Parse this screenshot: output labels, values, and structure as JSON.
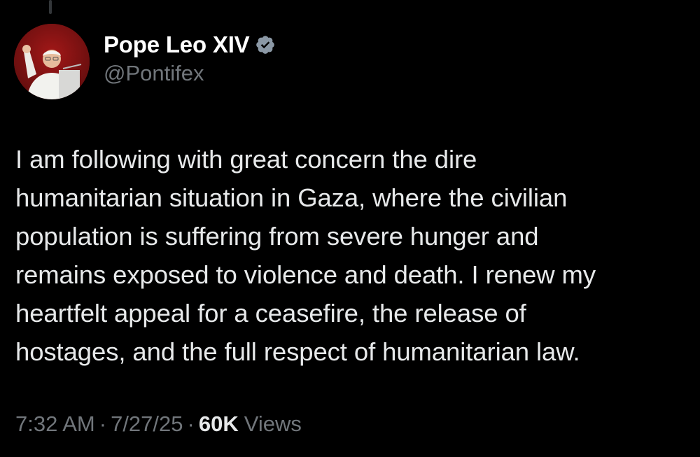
{
  "author": {
    "display_name": "Pope Leo XIV",
    "handle": "@Pontifex",
    "verified": true,
    "verified_icon": "verified-badge-icon",
    "verified_color": "#8b98a5"
  },
  "tweet": {
    "text": "I am following with great concern the dire\nhumanitarian situation in Gaza, where the civilian\npopulation is suffering from severe hunger and\nremains exposed to violence and death. I renew my\nheartfelt appeal for a ceasefire, the release of\nhostages, and the full respect of humanitarian law.",
    "time": "7:32 AM",
    "separator": "·",
    "date": "7/27/25",
    "views_count": "60K",
    "views_label": "Views"
  },
  "colors": {
    "background": "#000000",
    "primary_text": "#e7e9ea",
    "secondary_text": "#71767b"
  }
}
